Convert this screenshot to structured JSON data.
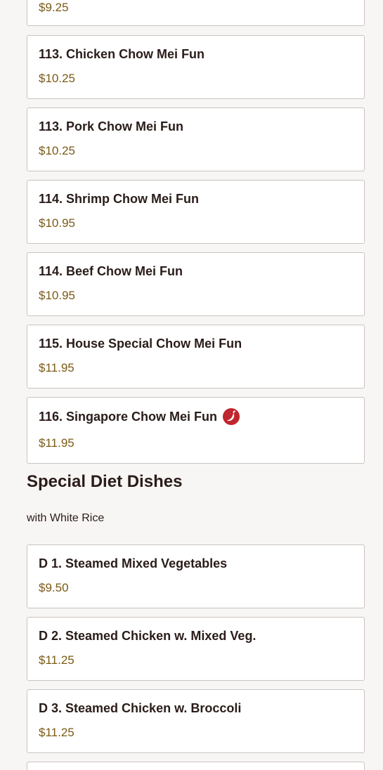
{
  "items_top": [
    {
      "price": "$9.25"
    },
    {
      "name": "113. Chicken Chow Mei Fun",
      "price": "$10.25"
    },
    {
      "name": "113. Pork Chow Mei Fun",
      "price": "$10.25"
    },
    {
      "name": "114. Shrimp Chow Mei Fun",
      "price": "$10.95"
    },
    {
      "name": "114. Beef Chow Mei Fun",
      "price": "$10.95"
    },
    {
      "name": "115. House Special Chow Mei Fun",
      "price": "$11.95"
    },
    {
      "name": "116. Singapore Chow Mei Fun",
      "price": "$11.95",
      "spicy_icon": "chili-pepper-icon"
    }
  ],
  "section": {
    "title": "Special Diet Dishes",
    "description": "with White Rice"
  },
  "items_diet": [
    {
      "name": "D 1. Steamed Mixed Vegetables",
      "price": "$9.50"
    },
    {
      "name": "D 2. Steamed Chicken w. Mixed Veg.",
      "price": "$11.25"
    },
    {
      "name": "D 3. Steamed Chicken w. Broccoli",
      "price": "$11.25"
    }
  ],
  "colors": {
    "price": "#7a5a16",
    "spicy": "#c0262d",
    "border": "#c9c3c0",
    "background": "#f8f6f4"
  }
}
